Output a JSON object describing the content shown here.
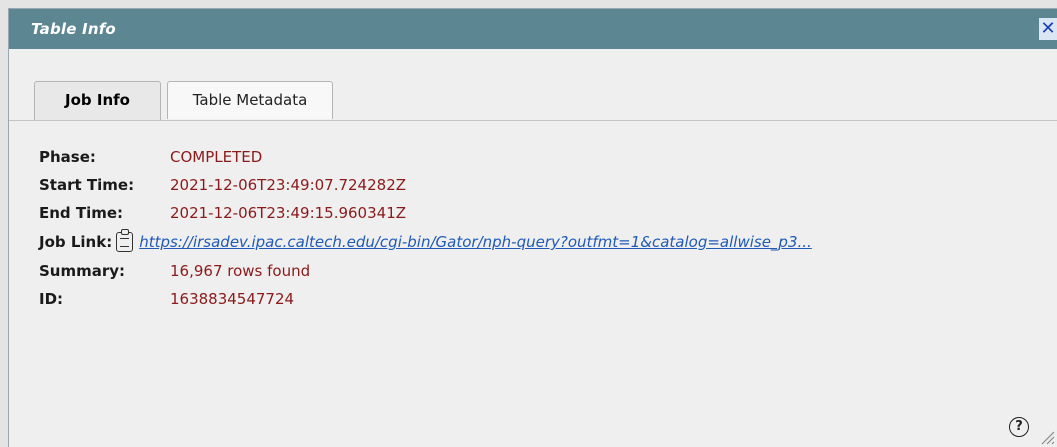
{
  "dialog": {
    "title": "Table Info",
    "close_label": "✕"
  },
  "tabs": [
    {
      "label": "Job Info",
      "active": true
    },
    {
      "label": "Table Metadata",
      "active": false
    }
  ],
  "job_info": {
    "phase": {
      "label": "Phase:",
      "value": "COMPLETED"
    },
    "start_time": {
      "label": "Start Time:",
      "value": "2021-12-06T23:49:07.724282Z"
    },
    "end_time": {
      "label": "End Time:",
      "value": "2021-12-06T23:49:15.960341Z"
    },
    "job_link": {
      "label": "Job Link:",
      "value": "https://irsadev.ipac.caltech.edu/cgi-bin/Gator/nph-query?outfmt=1&catalog=allwise_p3..."
    },
    "summary": {
      "label": "Summary:",
      "value": "16,967 rows found"
    },
    "id": {
      "label": "ID:",
      "value": "1638834547724"
    }
  },
  "footer": {
    "help_label": "?"
  },
  "colors": {
    "titlebar": "#5d8693",
    "value_text": "#8b1a1a",
    "link": "#1f5ab8"
  },
  "icons": {
    "close": "close-icon",
    "copy": "clipboard-icon",
    "help": "help-icon",
    "resize": "resize-grip-icon"
  }
}
